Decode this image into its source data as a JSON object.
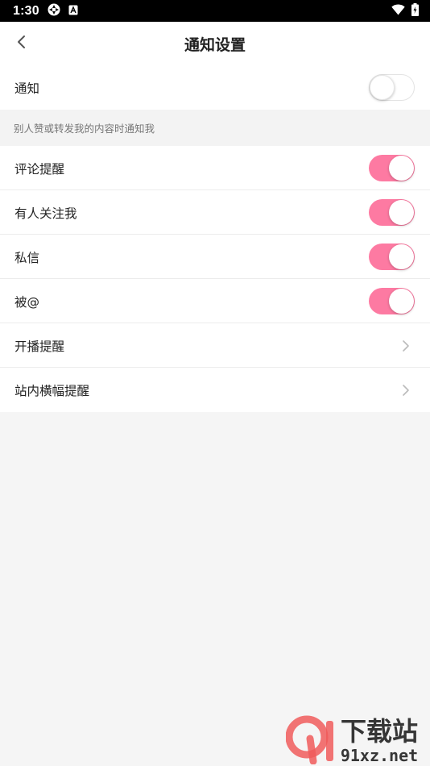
{
  "status_bar": {
    "time": "1:30"
  },
  "header": {
    "title": "通知设置"
  },
  "notification_master": {
    "label": "通知",
    "enabled": false
  },
  "section_note": "别人赞或转发我的内容时通知我",
  "settings": [
    {
      "label": "评论提醒",
      "type": "toggle",
      "enabled": true
    },
    {
      "label": "有人关注我",
      "type": "toggle",
      "enabled": true
    },
    {
      "label": "私信",
      "type": "toggle",
      "enabled": true
    },
    {
      "label": "被@",
      "type": "toggle",
      "enabled": true
    },
    {
      "label": "开播提醒",
      "type": "link"
    },
    {
      "label": "站内横幅提醒",
      "type": "link"
    }
  ],
  "watermark": {
    "brand": "下载站",
    "domain": "91xz.net"
  },
  "colors": {
    "accent": "#fd7aa2",
    "background": "#f5f5f5"
  }
}
